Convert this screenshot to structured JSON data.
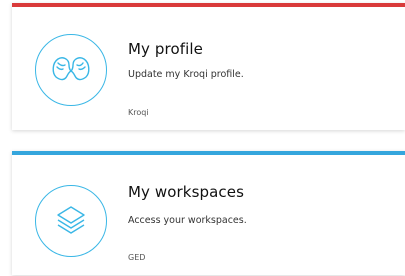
{
  "cards": [
    {
      "title": "My profile",
      "description": "Update my Kroqi profile.",
      "source": "Kroqi",
      "accent_color": "#d93a3a",
      "icon": "profile-faces-icon"
    },
    {
      "title": "My workspaces",
      "description": "Access your workspaces.",
      "source": "GED",
      "accent_color": "#35a6dd",
      "icon": "layers-icon"
    }
  ],
  "icon_color": "#3ab7e6"
}
